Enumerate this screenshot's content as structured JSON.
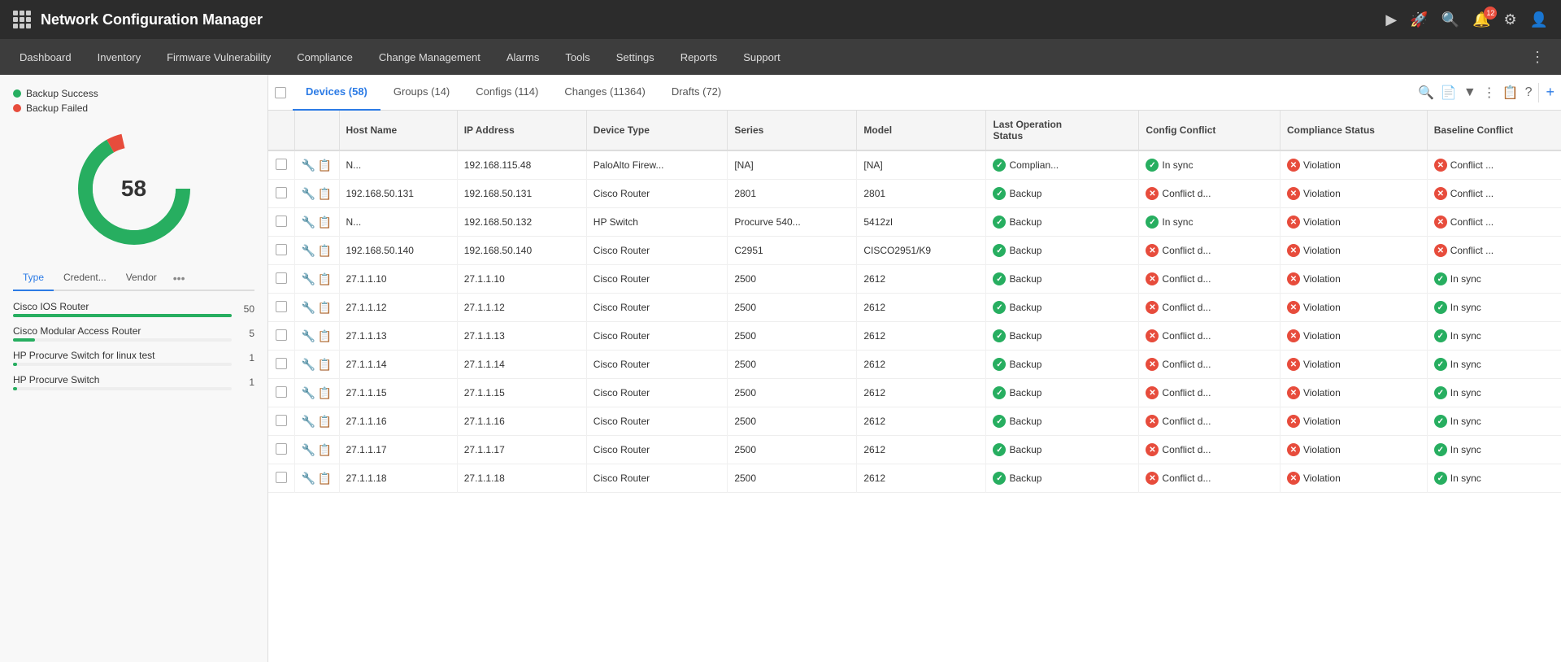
{
  "app": {
    "title": "Network Configuration Manager",
    "notifications_count": "12"
  },
  "nav": {
    "items": [
      "Dashboard",
      "Inventory",
      "Firmware Vulnerability",
      "Compliance",
      "Change Management",
      "Alarms",
      "Tools",
      "Settings",
      "Reports",
      "Support"
    ]
  },
  "tabs": [
    {
      "label": "Devices (58)",
      "active": true
    },
    {
      "label": "Groups (14)",
      "active": false
    },
    {
      "label": "Configs (114)",
      "active": false
    },
    {
      "label": "Changes (11364)",
      "active": false
    },
    {
      "label": "Drafts (72)",
      "active": false
    }
  ],
  "sidebar": {
    "donut": {
      "total": "58",
      "legend": [
        {
          "label": "Backup Success",
          "color": "#27ae60"
        },
        {
          "label": "Backup Failed",
          "color": "#e74c3c"
        }
      ]
    },
    "tabs": [
      "Type",
      "Credent...",
      "Vendor",
      "..."
    ],
    "device_types": [
      {
        "name": "Cisco IOS Router",
        "count": 50,
        "max": 50
      },
      {
        "name": "Cisco Modular Access Router",
        "count": 5,
        "max": 50
      },
      {
        "name": "HP Procurve Switch for linux test",
        "count": 1,
        "max": 50
      },
      {
        "name": "HP Procurve Switch",
        "count": 1,
        "max": 50
      }
    ]
  },
  "table": {
    "columns": [
      "",
      "",
      "Host Name",
      "IP Address",
      "Device Type",
      "Series",
      "Model",
      "Last Operation Status",
      "Config Conflict",
      "Compliance Status",
      "Baseline Conflict"
    ],
    "rows": [
      {
        "hostname": "N...",
        "ip": "192.168.115.48",
        "ip_display": "192.168.115.48",
        "device_type": "PaloAlto Firew...",
        "series": "[NA]",
        "model": "[NA]",
        "last_op": "Complian...",
        "last_op_ok": true,
        "config_conflict_icon": "in_sync",
        "config_conflict_text": "In sync",
        "compliance_icon": "violation",
        "compliance_text": "Violation",
        "baseline_icon": "conflict",
        "baseline_text": "Conflict ..."
      },
      {
        "hostname": "192.168.50.131",
        "ip": "192.168.50.131",
        "ip_display": "192.168.50.131",
        "device_type": "Cisco Router",
        "series": "2801",
        "model": "2801",
        "last_op": "Backup",
        "last_op_ok": true,
        "config_conflict_icon": "conflict",
        "config_conflict_text": "Conflict d...",
        "compliance_icon": "violation",
        "compliance_text": "Violation",
        "baseline_icon": "conflict",
        "baseline_text": "Conflict ..."
      },
      {
        "hostname": "N...",
        "ip": "192.168.50.132",
        "ip_display": "192.168.50.132",
        "device_type": "HP Switch",
        "series": "Procurve 540...",
        "model": "5412zl",
        "last_op": "Backup",
        "last_op_ok": true,
        "config_conflict_icon": "in_sync",
        "config_conflict_text": "In sync",
        "compliance_icon": "violation",
        "compliance_text": "Violation",
        "baseline_icon": "conflict",
        "baseline_text": "Conflict ..."
      },
      {
        "hostname": "192.168.50.140",
        "ip": "192.168.50.140",
        "ip_display": "192.168.50.140",
        "device_type": "Cisco Router",
        "series": "C2951",
        "model": "CISCO2951/K9",
        "last_op": "Backup",
        "last_op_ok": true,
        "config_conflict_icon": "conflict",
        "config_conflict_text": "Conflict d...",
        "compliance_icon": "violation",
        "compliance_text": "Violation",
        "baseline_icon": "conflict",
        "baseline_text": "Conflict ..."
      },
      {
        "hostname": "27.1.1.10",
        "ip": "27.1.1.10",
        "ip_display": "27.1.1.10",
        "device_type": "Cisco Router",
        "series": "2500",
        "model": "2612",
        "last_op": "Backup",
        "last_op_ok": true,
        "config_conflict_icon": "conflict",
        "config_conflict_text": "Conflict d...",
        "compliance_icon": "violation",
        "compliance_text": "Violation",
        "baseline_icon": "in_sync",
        "baseline_text": "In sync"
      },
      {
        "hostname": "27.1.1.12",
        "ip": "27.1.1.12",
        "ip_display": "27.1.1.12",
        "device_type": "Cisco Router",
        "series": "2500",
        "model": "2612",
        "last_op": "Backup",
        "last_op_ok": true,
        "config_conflict_icon": "conflict",
        "config_conflict_text": "Conflict d...",
        "compliance_icon": "violation",
        "compliance_text": "Violation",
        "baseline_icon": "in_sync",
        "baseline_text": "In sync"
      },
      {
        "hostname": "27.1.1.13",
        "ip": "27.1.1.13",
        "ip_display": "27.1.1.13",
        "device_type": "Cisco Router",
        "series": "2500",
        "model": "2612",
        "last_op": "Backup",
        "last_op_ok": true,
        "config_conflict_icon": "conflict",
        "config_conflict_text": "Conflict d...",
        "compliance_icon": "violation",
        "compliance_text": "Violation",
        "baseline_icon": "in_sync",
        "baseline_text": "In sync"
      },
      {
        "hostname": "27.1.1.14",
        "ip": "27.1.1.14",
        "ip_display": "27.1.1.14",
        "device_type": "Cisco Router",
        "series": "2500",
        "model": "2612",
        "last_op": "Backup",
        "last_op_ok": true,
        "config_conflict_icon": "conflict",
        "config_conflict_text": "Conflict d...",
        "compliance_icon": "violation",
        "compliance_text": "Violation",
        "baseline_icon": "in_sync",
        "baseline_text": "In sync"
      },
      {
        "hostname": "27.1.1.15",
        "ip": "27.1.1.15",
        "ip_display": "27.1.1.15",
        "device_type": "Cisco Router",
        "series": "2500",
        "model": "2612",
        "last_op": "Backup",
        "last_op_ok": true,
        "config_conflict_icon": "conflict",
        "config_conflict_text": "Conflict d...",
        "compliance_icon": "violation",
        "compliance_text": "Violation",
        "baseline_icon": "in_sync",
        "baseline_text": "In sync"
      },
      {
        "hostname": "27.1.1.16",
        "ip": "27.1.1.16",
        "ip_display": "27.1.1.16",
        "device_type": "Cisco Router",
        "series": "2500",
        "model": "2612",
        "last_op": "Backup",
        "last_op_ok": true,
        "config_conflict_icon": "conflict",
        "config_conflict_text": "Conflict d...",
        "compliance_icon": "violation",
        "compliance_text": "Violation",
        "baseline_icon": "in_sync",
        "baseline_text": "In sync"
      },
      {
        "hostname": "27.1.1.17",
        "ip": "27.1.1.17",
        "ip_display": "27.1.1.17",
        "device_type": "Cisco Router",
        "series": "2500",
        "model": "2612",
        "last_op": "Backup",
        "last_op_ok": true,
        "config_conflict_icon": "conflict",
        "config_conflict_text": "Conflict d...",
        "compliance_icon": "violation",
        "compliance_text": "Violation",
        "baseline_icon": "in_sync",
        "baseline_text": "In sync"
      },
      {
        "hostname": "27.1.1.18",
        "ip": "27.1.1.18",
        "ip_display": "27.1.1.18",
        "device_type": "Cisco Router",
        "series": "2500",
        "model": "2612",
        "last_op": "Backup",
        "last_op_ok": true,
        "config_conflict_icon": "conflict",
        "config_conflict_text": "Conflict d...",
        "compliance_icon": "violation",
        "compliance_text": "Violation",
        "baseline_icon": "in_sync",
        "baseline_text": "In sync"
      }
    ]
  }
}
